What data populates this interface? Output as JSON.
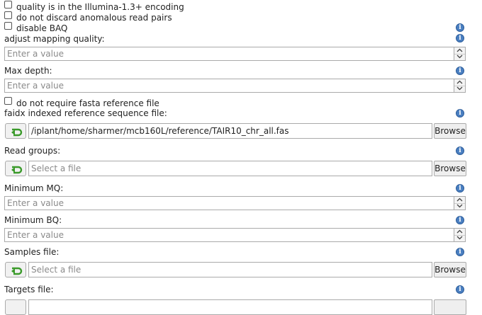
{
  "options": {
    "illumina_label": "quality is in the Illumina-1.3+ encoding",
    "anomalous_label": "do not discard anomalous read pairs",
    "baq_label": "disable BAQ",
    "fasta_label": "do not require fasta reference file"
  },
  "fields": {
    "adjust_mq": {
      "label": "adjust mapping quality:",
      "placeholder": "Enter a value"
    },
    "max_depth": {
      "label": "Max depth:",
      "placeholder": "Enter a value"
    },
    "faidx": {
      "label": "faidx indexed reference sequence file:",
      "value": "/iplant/home/sharmer/mcb160L/reference/TAIR10_chr_all.fas",
      "browse_label": "Browse"
    },
    "read_groups": {
      "label": "Read groups:",
      "placeholder": "Select a file",
      "browse_label": "Browse"
    },
    "min_mq": {
      "label": "Minimum MQ:",
      "placeholder": "Enter a value"
    },
    "min_bq": {
      "label": "Minimum BQ:",
      "placeholder": "Enter a value"
    },
    "samples": {
      "label": "Samples file:",
      "placeholder": "Select a file",
      "browse_label": "Browse"
    },
    "targets": {
      "label": "Targets file:"
    }
  },
  "colors": {
    "info_icon": "#4a7fc1",
    "reset_arrow": "#3a9a2a"
  },
  "icons": {
    "info": "info-icon",
    "reset": "reset-arrow-icon"
  }
}
